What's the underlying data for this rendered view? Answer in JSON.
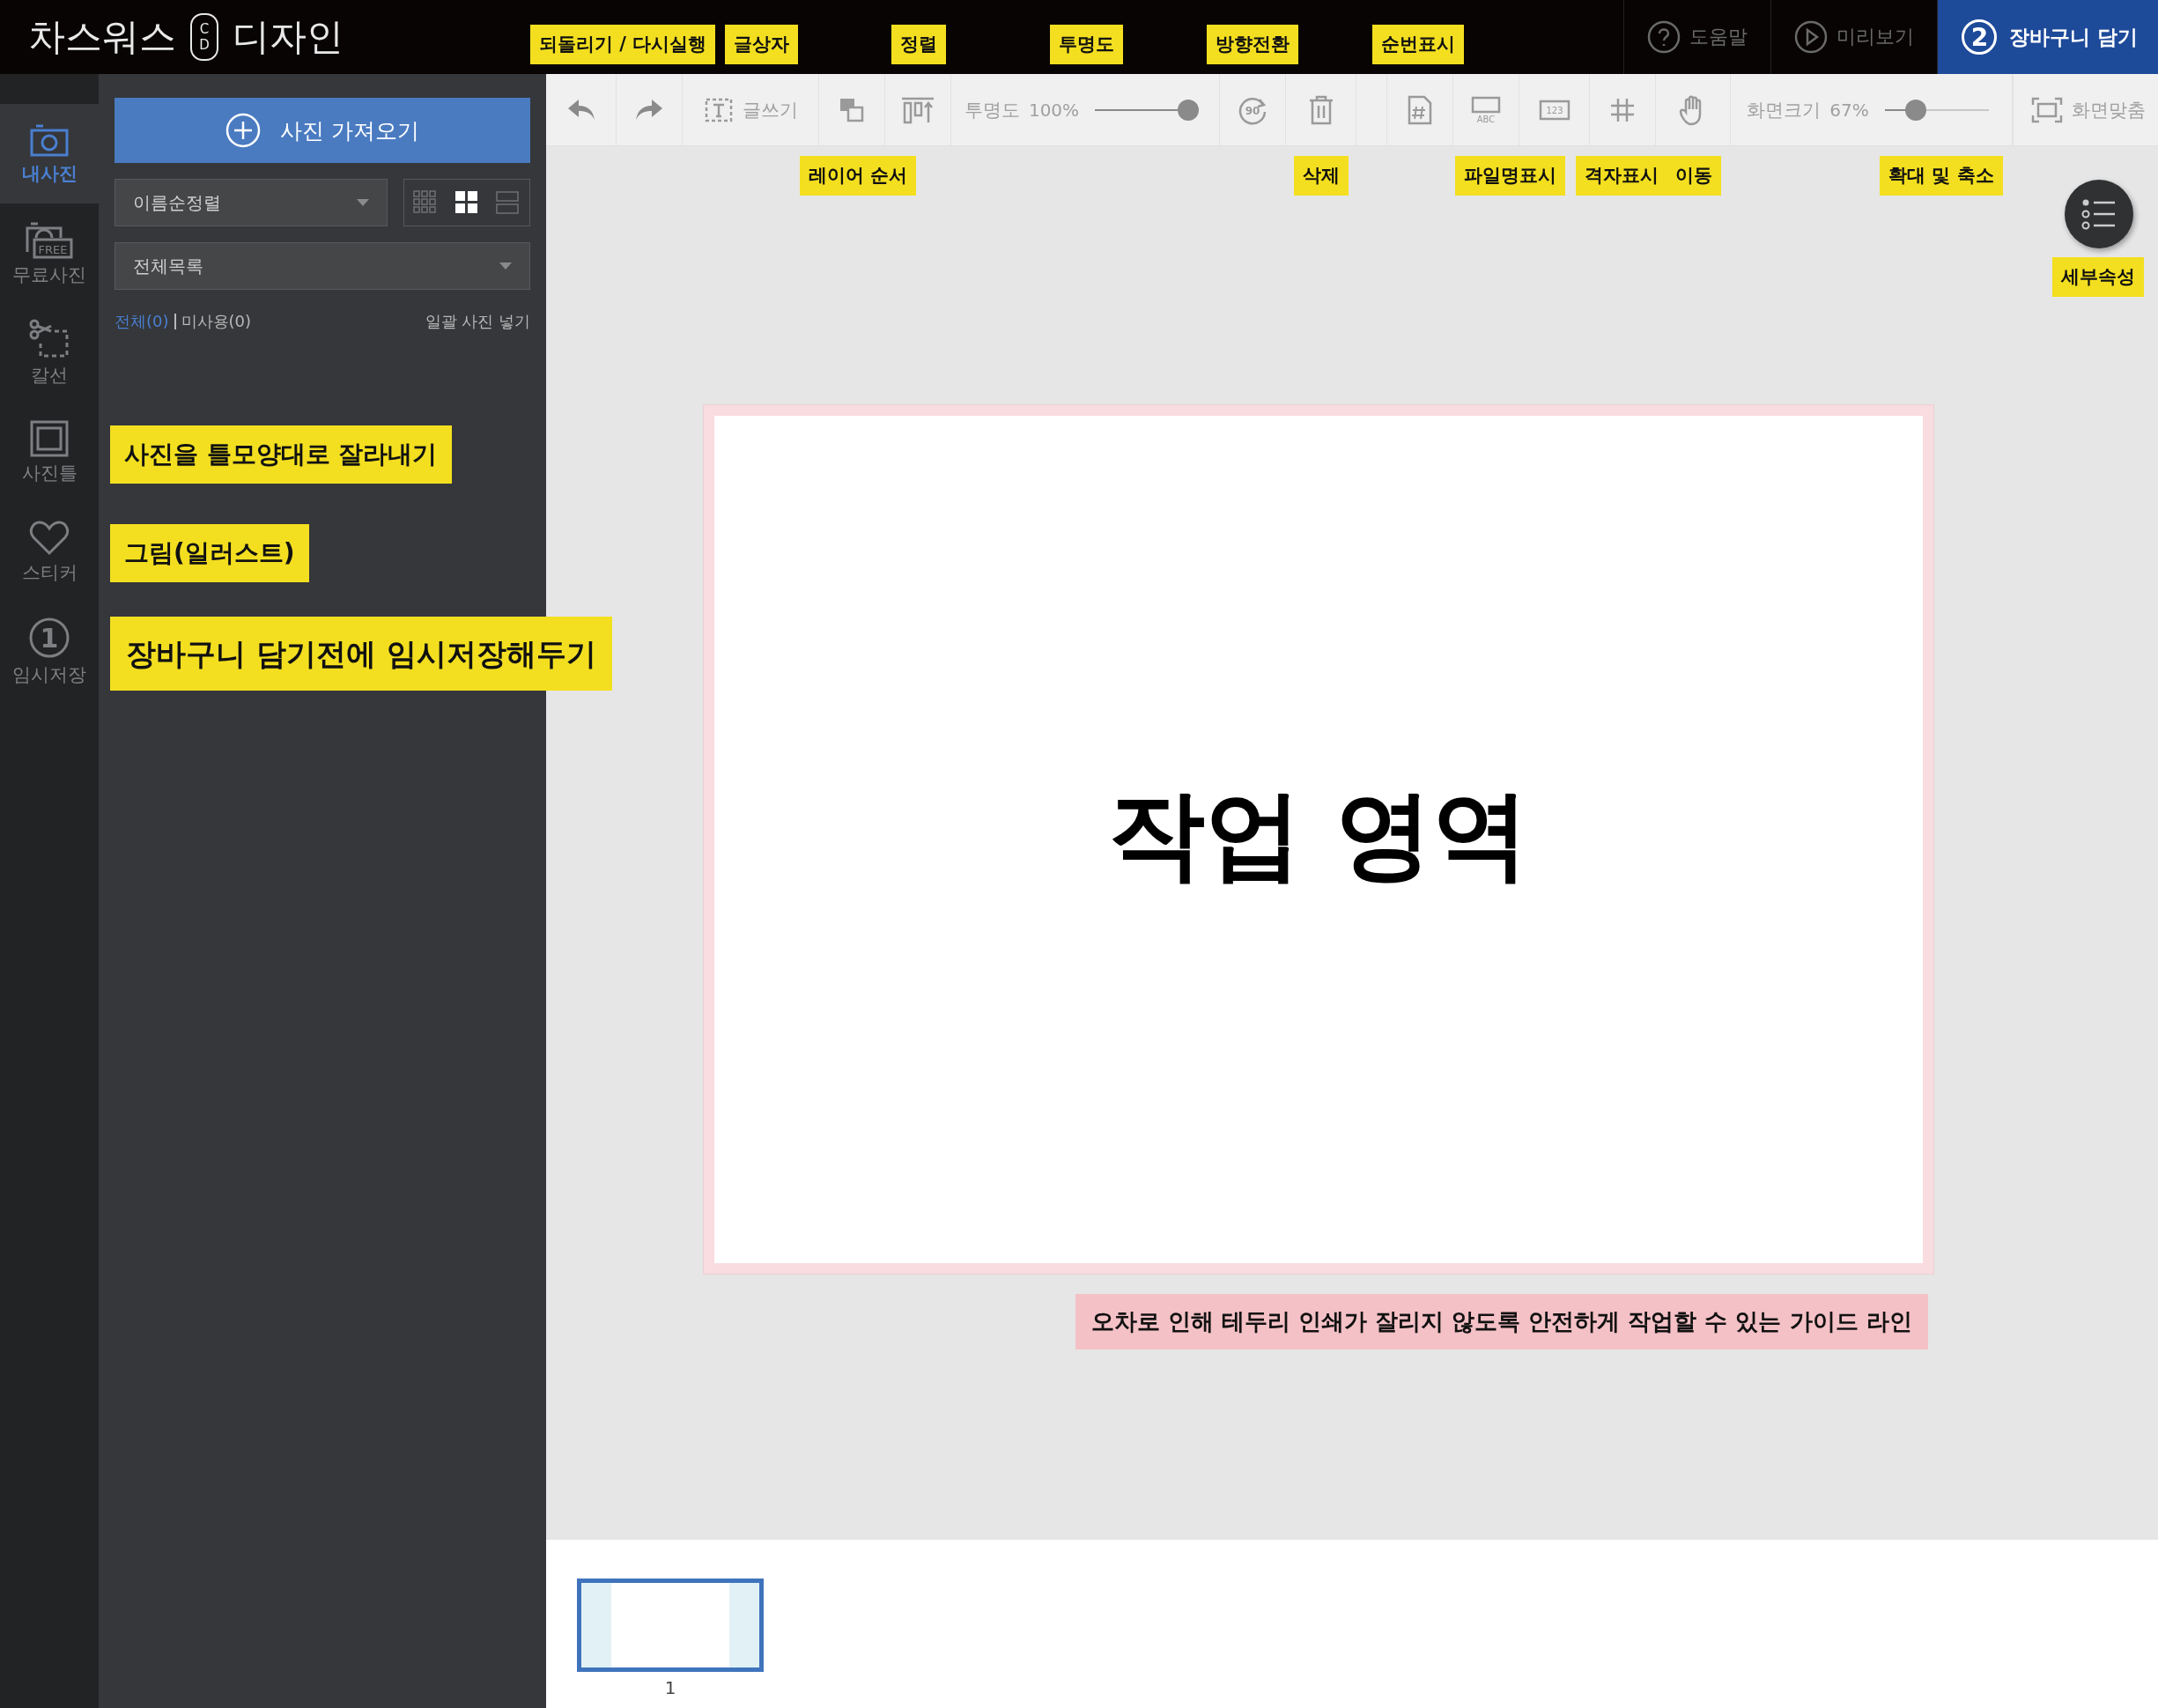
{
  "app": {
    "name_left": "차스워스",
    "mark_top": "C",
    "mark_bottom": "D",
    "name_right": "디자인"
  },
  "header_actions": [
    {
      "kind": "help",
      "label": "도움말"
    },
    {
      "kind": "preview",
      "label": "미리보기"
    },
    {
      "kind": "cart",
      "number": "2",
      "label": "장바구니 담기"
    }
  ],
  "rail": [
    {
      "kind": "camera",
      "label": "내사진",
      "selected": true
    },
    {
      "kind": "free",
      "icon_text": "FREE",
      "label": "무료사진",
      "selected": false
    },
    {
      "kind": "cut",
      "label": "칼선",
      "selected": false
    },
    {
      "kind": "frame",
      "label": "사진틀",
      "selected": false
    },
    {
      "kind": "heart",
      "label": "스티커",
      "selected": false
    },
    {
      "kind": "number",
      "icon_text": "1",
      "label": "임시저장",
      "selected": false
    }
  ],
  "panel": {
    "import_button": "사진 가져오기",
    "sort_select": "이름순정렬",
    "view_modes": [
      {
        "kind": "small",
        "selected": false
      },
      {
        "kind": "large",
        "selected": true
      },
      {
        "kind": "list",
        "selected": false
      }
    ],
    "folder_select": "전체목록",
    "filters": [
      {
        "label": "전체(0)",
        "selected": true
      },
      {
        "label": "미사용(0)",
        "selected": false
      }
    ],
    "bulk_insert": "일괄 사진 넣기"
  },
  "toolbar": [
    {
      "kind": "undo"
    },
    {
      "kind": "redo"
    },
    {
      "kind": "text",
      "label": "글쓰기"
    },
    {
      "kind": "layer"
    },
    {
      "kind": "align"
    },
    {
      "kind": "opacity",
      "label": "투명도",
      "reading": "100%",
      "level": 1
    },
    {
      "kind": "rotate",
      "icon_text": "90"
    },
    {
      "kind": "delete"
    },
    {
      "kind": "spacer"
    },
    {
      "kind": "number"
    },
    {
      "kind": "filename",
      "icon_text": "ABC"
    },
    {
      "kind": "sequence",
      "icon_text": "123"
    },
    {
      "kind": "grid"
    },
    {
      "kind": "move"
    },
    {
      "kind": "zoom",
      "label": "화면크기",
      "reading": "67%",
      "level": 0.25
    },
    {
      "kind": "fit",
      "label": "화면맞춤"
    }
  ],
  "canvas": {
    "work_area_label": "작업 영역",
    "guide_note": "오차로 인해 테두리 인쇄가 잘리지 않도록 안전하게 작업할 수 있는 가이드 라인"
  },
  "pages": [
    {
      "number": "1",
      "selected": true
    }
  ],
  "annotations": [
    "되돌리기 / 다시실행",
    "글상자",
    "정렬",
    "투명도",
    "방향전환",
    "순번표시",
    "레이어 순서",
    "삭제",
    "파일명표시",
    "격자표시",
    "이동",
    "확대 및 축소",
    "세부속성",
    "사진을 틀모양대로 잘라내기",
    "그림(일러스트)",
    "장바구니 담기전에 임시저장해두기"
  ]
}
